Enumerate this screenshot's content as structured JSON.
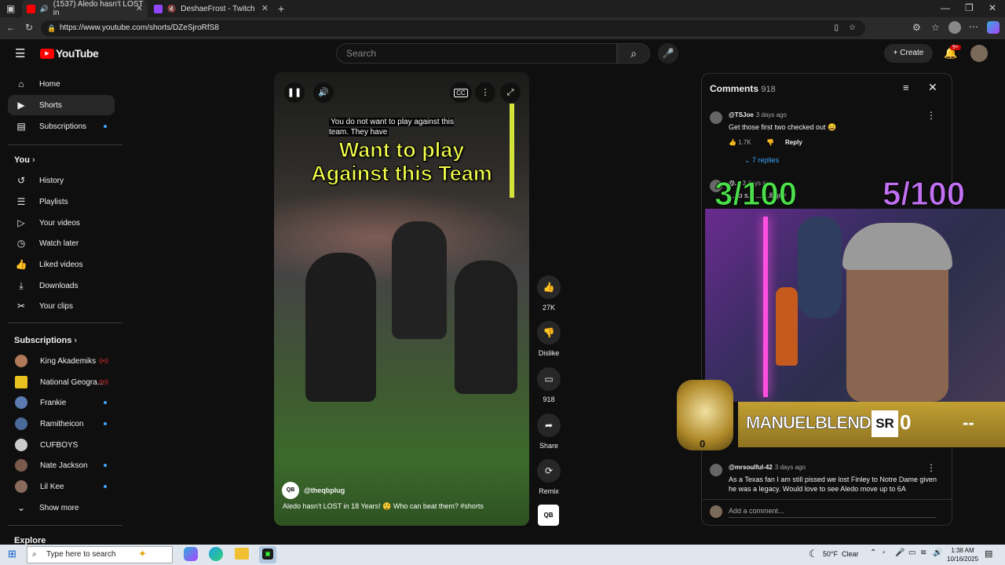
{
  "browser": {
    "tabs": [
      {
        "title": "(1537) Aledo hasn't LOST in",
        "color": "#ff0000"
      },
      {
        "title": "DeshaeFrost - Twitch",
        "color": "#9146ff"
      }
    ],
    "url": "https://www.youtube.com/shorts/DZeSjroRfS8"
  },
  "header": {
    "logo": "YouTube",
    "search_placeholder": "Search",
    "create_label": "Create",
    "notif_badge": "9+"
  },
  "sidebar": {
    "main": [
      {
        "label": "Home",
        "icon": "home-icon",
        "glyph": "⌂"
      },
      {
        "label": "Shorts",
        "icon": "shorts-icon",
        "glyph": "▶"
      },
      {
        "label": "Subscriptions",
        "icon": "subscriptions-icon",
        "glyph": "▤"
      }
    ],
    "you_heading": "You",
    "you": [
      {
        "label": "History",
        "icon": "history-icon",
        "glyph": "↺"
      },
      {
        "label": "Playlists",
        "icon": "playlists-icon",
        "glyph": "☰"
      },
      {
        "label": "Your videos",
        "icon": "your-videos-icon",
        "glyph": "▷"
      },
      {
        "label": "Watch later",
        "icon": "watch-later-icon",
        "glyph": "◷"
      },
      {
        "label": "Liked videos",
        "icon": "liked-videos-icon",
        "glyph": "👍"
      },
      {
        "label": "Downloads",
        "icon": "downloads-icon",
        "glyph": "⤓"
      },
      {
        "label": "Your clips",
        "icon": "clips-icon",
        "glyph": "✂"
      }
    ],
    "subs_heading": "Subscriptions",
    "subs": [
      {
        "label": "King Akademiks",
        "color": "#b07a5a",
        "live": true
      },
      {
        "label": "National Geogra...",
        "color": "#e8c020",
        "live": true
      },
      {
        "label": "Frankie",
        "color": "#5a7ab0",
        "live": false
      },
      {
        "label": "Ramitheicon",
        "color": "#4a6a9a",
        "live": false
      },
      {
        "label": "CUFBOYS",
        "color": "#cccccc",
        "live": false
      },
      {
        "label": "Nate Jackson",
        "color": "#7a5a4a",
        "live": false
      },
      {
        "label": "Lil Kee",
        "color": "#8a6a5a",
        "live": false
      }
    ],
    "show_more": "Show more",
    "explore": "Explore"
  },
  "video": {
    "caption": "You do not want to play against this team. They have",
    "overlay_line1": "Want to play",
    "overlay_line2": "Against this Team",
    "channel": "@theqbplug",
    "channel_logo": "QB",
    "title": "Aledo hasn't LOST in 18 Years! 😲 Who can beat them? #shorts",
    "cc": "CC"
  },
  "actions": {
    "likes": "27K",
    "dislike": "Dislike",
    "comments": "918",
    "share": "Share",
    "remix": "Remix"
  },
  "comments_panel": {
    "title": "Comments",
    "count": "918",
    "items": [
      {
        "author": "@TSJoe",
        "ago": "3 days ago",
        "text": "Get those first two checked out 😄",
        "likes": "1.7K",
        "reply": "Reply",
        "replies": "7 replies"
      },
      {
        "author": "@...",
        "ago": "3 days ago",
        "text": "...ab s... ... ...ll guy"
      },
      {
        "author": "@mrsoulful-42",
        "ago": "3 days ago",
        "text": "As a Texas fan I am still pissed we lost Finley to Notre Dame given he was a legacy. Would love to see Aledo move up to 6A"
      }
    ],
    "add_comment": "Add a comment..."
  },
  "stream": {
    "counter_left": "3/100",
    "counter_right": "5/100",
    "name": "MANUELBLENDZ",
    "sr_label": "SR",
    "sr_value": "0",
    "dash": "--",
    "badge_num": "0"
  },
  "taskbar": {
    "search": "Type here to search",
    "weather_temp": "50°F",
    "weather_desc": "Clear",
    "time": "1:38 AM",
    "date": "10/16/2025"
  }
}
